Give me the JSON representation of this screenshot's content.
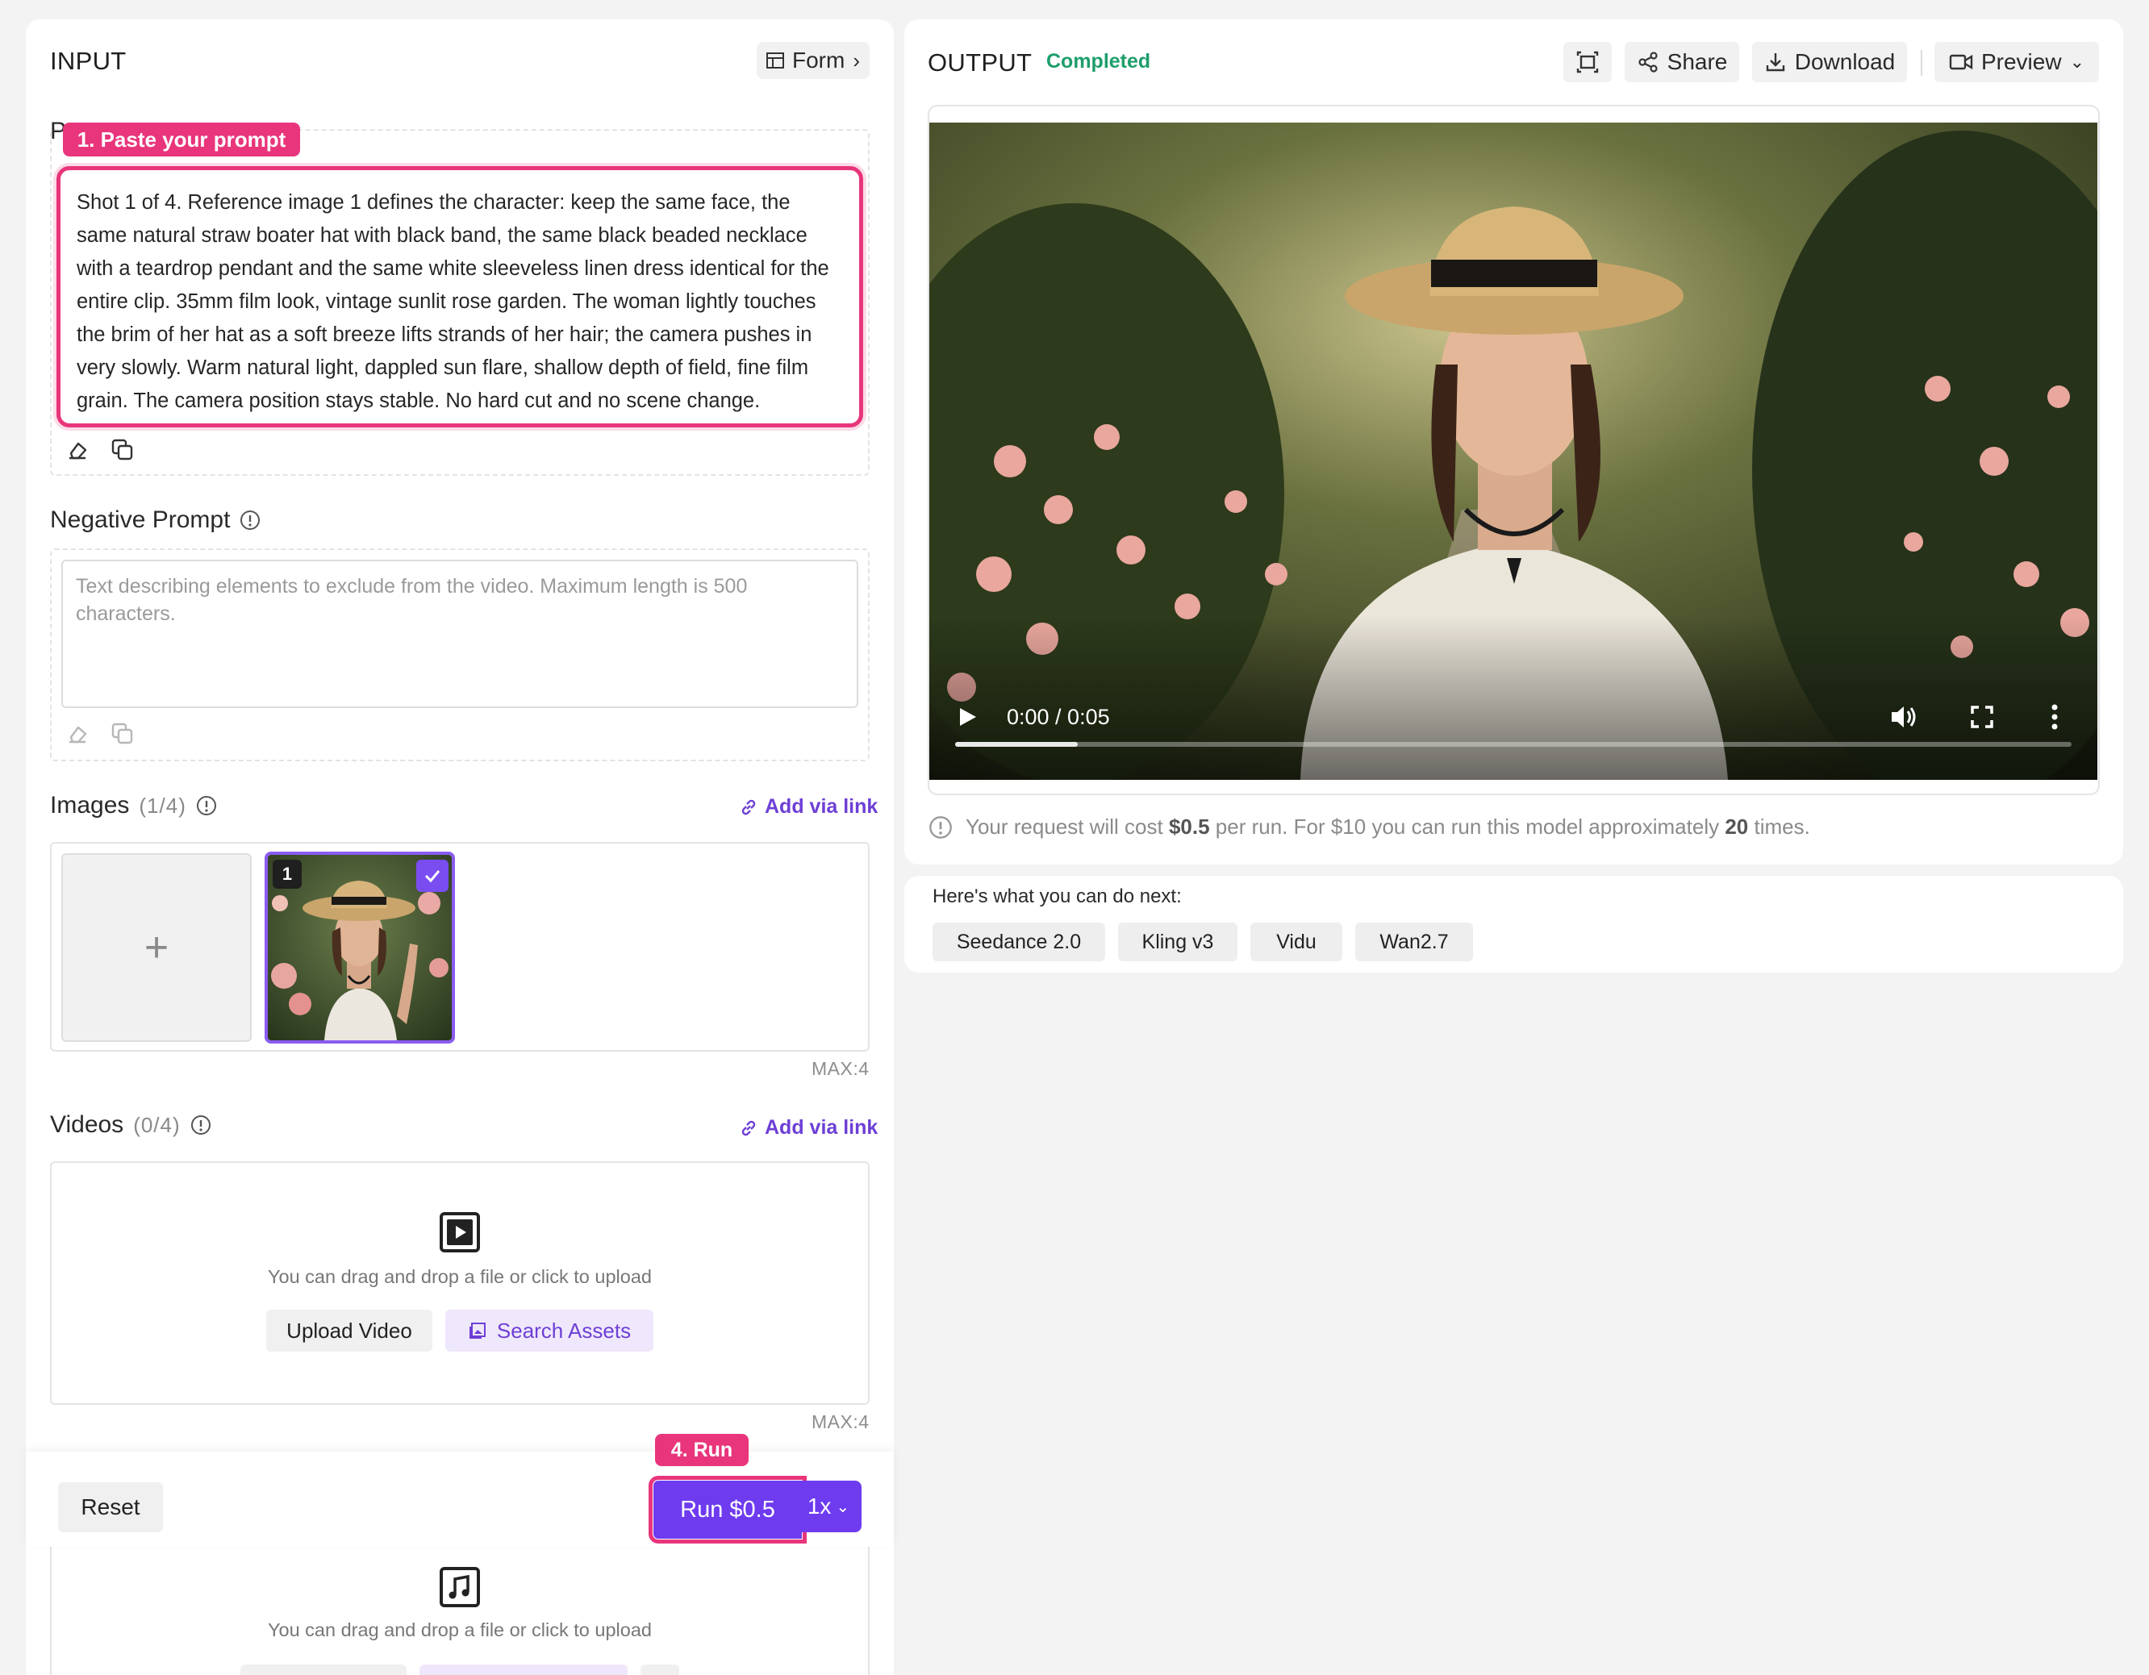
{
  "input": {
    "title": "INPUT",
    "form_label": "Form",
    "prompt_label_partial": "P",
    "badge_prompt": "1. Paste your prompt",
    "prompt_text": "Shot 1 of 4. Reference image 1 defines the character: keep the same face, the same natural straw boater hat with black band, the same black beaded necklace with a teardrop pendant and the same white sleeveless linen dress identical for the entire clip. 35mm film look, vintage sunlit rose garden. The woman lightly touches the brim of her hat as a soft breeze lifts strands of her hair; the camera pushes in very slowly. Warm natural light, dappled sun flare, shallow depth of field, fine film grain. The camera position stays stable. No hard cut and no scene change.",
    "negative": {
      "label": "Negative Prompt",
      "placeholder": "Text describing elements to exclude from the video. Maximum length is 500 characters."
    },
    "images": {
      "label": "Images",
      "count": "(1/4)",
      "add_link": "Add via link",
      "thumb_index": "1",
      "max": "MAX:4"
    },
    "videos": {
      "label": "Videos",
      "count": "(0/4)",
      "add_link": "Add via link",
      "drop_hint": "You can drag and drop a file or click to upload",
      "upload_label": "Upload Video",
      "search_label": "Search Assets",
      "max": "MAX:4"
    },
    "audio": {
      "drop_hint": "You can drag and drop a file or click to upload"
    },
    "footer": {
      "reset_label": "Reset",
      "badge_run": "4. Run",
      "run_label": "Run $0.5",
      "multiplier": "1x"
    }
  },
  "output": {
    "title": "OUTPUT",
    "status": "Completed",
    "status_color": "#1e9e6b",
    "share_label": "Share",
    "download_label": "Download",
    "preview_label": "Preview",
    "player": {
      "time": "0:00 / 0:05",
      "progress": 0.11
    },
    "cost": {
      "prefix": "Your request will cost ",
      "amount": "$0.5",
      "middle": " per run. For $10 you can run this model approximately ",
      "times": "20",
      "suffix": " times."
    }
  },
  "next": {
    "heading": "Here's what you can do next:",
    "models": [
      "Seedance 2.0",
      "Kling v3",
      "Vidu",
      "Wan2.7"
    ]
  },
  "colors": {
    "accent": "#6e3bef",
    "highlight": "#e8357b",
    "link": "#6d3fd6"
  }
}
